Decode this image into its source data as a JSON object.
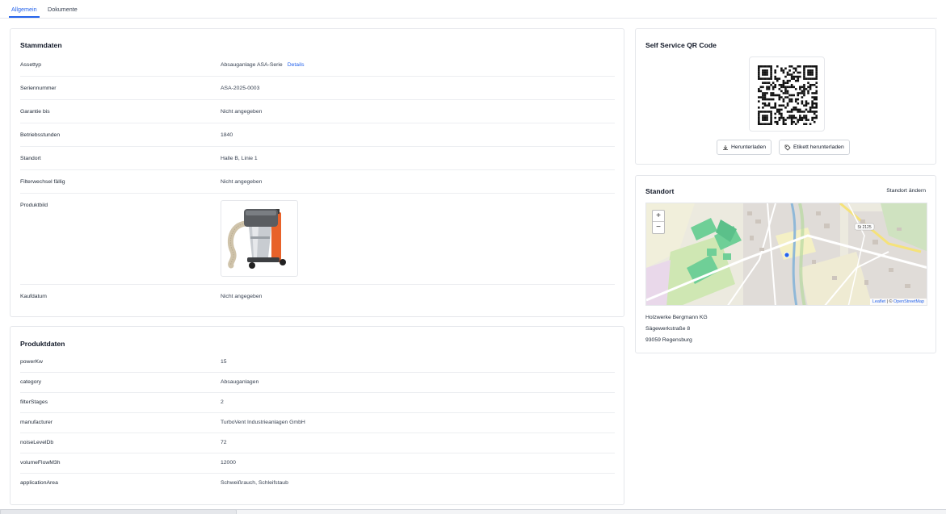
{
  "tabs": [
    {
      "label": "Allgemein",
      "active": true
    },
    {
      "label": "Dokumente",
      "active": false
    }
  ],
  "stammdaten": {
    "title": "Stammdaten",
    "rows": [
      {
        "label": "Assettyp",
        "value": "Absauganlage ASA-Serie",
        "link": "Details"
      },
      {
        "label": "Seriennummer",
        "value": "ASA-2025-0003"
      },
      {
        "label": "Garantie bis",
        "value": "Nicht angegeben"
      },
      {
        "label": "Betriebsstunden",
        "value": "1840"
      },
      {
        "label": "Standort",
        "value": "Halle B, Linie 1"
      },
      {
        "label": "Filterwechsel fällig",
        "value": "Nicht angegeben"
      },
      {
        "label": "Produktbild",
        "value": ""
      },
      {
        "label": "Kaufdatum",
        "value": "Nicht angegeben"
      }
    ]
  },
  "produktdaten": {
    "title": "Produktdaten",
    "rows": [
      {
        "label": "powerKw",
        "value": "15"
      },
      {
        "label": "category",
        "value": "Absauganlagen"
      },
      {
        "label": "filterStages",
        "value": "2"
      },
      {
        "label": "manufacturer",
        "value": "TurboVent Industrieanlagen GmbH"
      },
      {
        "label": "noiseLevelDb",
        "value": "72"
      },
      {
        "label": "volumeFlowM3h",
        "value": "12000"
      },
      {
        "label": "applicationArea",
        "value": "Schweißrauch, Schleifstaub"
      }
    ]
  },
  "qr": {
    "title": "Self Service QR Code",
    "download_label": "Herunterladen",
    "label_download_label": "Etikett herunterladen"
  },
  "standort": {
    "title": "Standort",
    "change_label": "Standort ändern",
    "map": {
      "zoom_in": "+",
      "zoom_out": "−",
      "road_label": "St 2125",
      "attribution_leaflet": "Leaflet",
      "attribution_sep": " | © ",
      "attribution_osm": "OpenStreetMap"
    },
    "address": {
      "company": "Holzwerke Bergmann KG",
      "street": "Sägewerkstraße 8",
      "city": "93059 Regensburg"
    }
  },
  "colors": {
    "accent": "#2563eb",
    "machine_orange": "#e8622a"
  }
}
